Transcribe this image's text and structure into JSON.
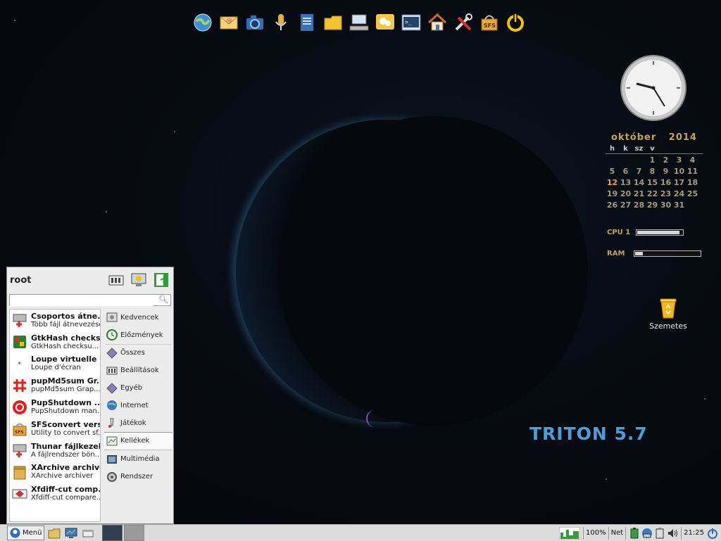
{
  "launcher": {
    "icons": [
      "browser-icon",
      "mail-icon",
      "camera-icon",
      "microphone-icon",
      "document-icon",
      "folder-icon",
      "network-icon",
      "chat-icon",
      "terminal-icon",
      "home-icon",
      "tools-icon",
      "sfs-icon",
      "power-icon"
    ]
  },
  "calendar": {
    "month": "október",
    "year": "2014",
    "weekdays": [
      "h",
      "k",
      "sz",
      "v",
      "",
      "",
      ""
    ],
    "today": "12",
    "days": [
      "",
      "",
      "",
      "",
      "",
      "",
      "",
      "",
      "",
      "",
      "1",
      "2",
      "3",
      "4",
      "5",
      "6",
      "7",
      "8",
      "9",
      "10",
      "11",
      "12",
      "13",
      "14",
      "15",
      "16",
      "17",
      "18",
      "19",
      "20",
      "21",
      "22",
      "23",
      "24",
      "25",
      "26",
      "27",
      "28",
      "29",
      "30",
      "31",
      "",
      ""
    ]
  },
  "meters": {
    "cpu_label": "CPU 1",
    "cpu_level": 0.9,
    "ram_label": "RAM",
    "ram_level": 0.12
  },
  "desktop": {
    "trash_label": "Szemetes",
    "brand": "TRITON 5.7"
  },
  "menu": {
    "user": "root",
    "search_value": "",
    "apps": [
      {
        "title": "Csoportos átne...",
        "subtitle": "Több fájl átnevezése",
        "icon": "rename-icon"
      },
      {
        "title": "GtkHash checks...",
        "subtitle": "GtkHash checksu...",
        "icon": "hash-icon"
      },
      {
        "title": "Loupe virtuelle",
        "subtitle": "Loupe d'écran",
        "icon": "loupe-icon"
      },
      {
        "title": "pupMd5sum Gr...",
        "subtitle": "pupMd5sum Grap...",
        "icon": "md5-icon"
      },
      {
        "title": "PupShutdown ...",
        "subtitle": "PupShutdown man...",
        "icon": "shutdown-icon"
      },
      {
        "title": "SFSconvert vers...",
        "subtitle": "Utility to convert sf...",
        "icon": "sfs-icon"
      },
      {
        "title": "Thunar fájlkezelő",
        "subtitle": "A fájlrendszer bön...",
        "icon": "filemanager-icon"
      },
      {
        "title": "XArchive archiver",
        "subtitle": "XArchive archiver",
        "icon": "archive-icon"
      },
      {
        "title": "Xfdiff-cut comp...",
        "subtitle": "Xfdiff-cut compare...",
        "icon": "diff-icon"
      }
    ],
    "categories": [
      {
        "label": "Kedvencek",
        "icon": "favorites-icon"
      },
      {
        "label": "Előzmények",
        "icon": "history-icon"
      },
      {
        "label": "Összes",
        "icon": "all-icon"
      },
      {
        "label": "Beállítások",
        "icon": "settings-icon"
      },
      {
        "label": "Egyéb",
        "icon": "other-icon"
      },
      {
        "label": "Internet",
        "icon": "internet-icon"
      },
      {
        "label": "Játékok",
        "icon": "games-icon"
      },
      {
        "label": "Kellékek",
        "icon": "accessories-icon"
      },
      {
        "label": "Multimédia",
        "icon": "multimedia-icon"
      },
      {
        "label": "Rendszer",
        "icon": "system-icon"
      }
    ],
    "selected_category": "Kellékek"
  },
  "taskbar": {
    "start_label": "Menü",
    "zoom": "100%",
    "net_label": "Net",
    "time": "21:25"
  },
  "colors": {
    "accent": "#4b9fd8",
    "calendar_text": "#c2a35d",
    "today": "#f1a52c"
  }
}
